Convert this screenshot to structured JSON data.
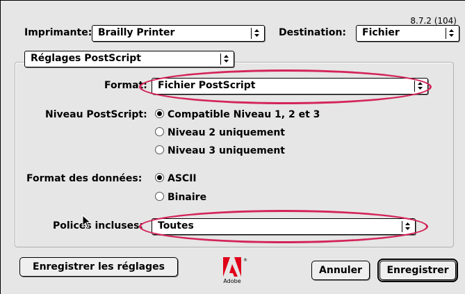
{
  "version": "8.7.2 (104)",
  "header": {
    "printer_label": "Imprimante:",
    "printer_value": "Brailly Printer",
    "destination_label": "Destination:",
    "destination_value": "Fichier"
  },
  "panel": {
    "value": "Réglages PostScript"
  },
  "format": {
    "label": "Format:",
    "value": "Fichier PostScript"
  },
  "level": {
    "label": "Niveau PostScript:",
    "options": [
      "Compatible Niveau 1, 2 et 3",
      "Niveau 2 uniquement",
      "Niveau 3 uniquement"
    ],
    "selected": 0
  },
  "data_format": {
    "label": "Format des données:",
    "options": [
      "ASCII",
      "Binaire"
    ],
    "selected": 0
  },
  "fonts": {
    "label": "Polices incluses:",
    "value": "Toutes"
  },
  "buttons": {
    "save_settings": "Enregistrer les réglages",
    "cancel": "Annuler",
    "save": "Enregistrer"
  },
  "logo": {
    "word": "Adobe"
  },
  "highlight_color": "#d4245a"
}
